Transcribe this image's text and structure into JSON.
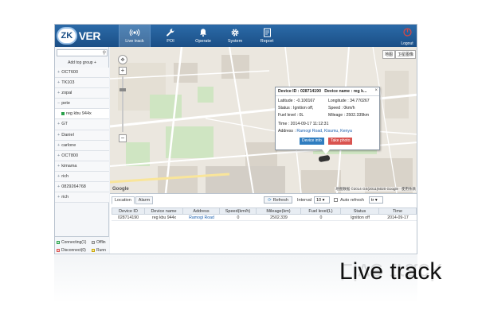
{
  "logo": {
    "mark": "ZK",
    "text": "VER"
  },
  "nav": [
    {
      "label": "Live track",
      "icon": "live-track-icon",
      "active": true
    },
    {
      "label": "POI",
      "icon": "wrench-icon"
    },
    {
      "label": "Operate",
      "icon": "bell-icon"
    },
    {
      "label": "System",
      "icon": "gear-icon"
    },
    {
      "label": "Report",
      "icon": "report-icon"
    }
  ],
  "logout": {
    "label": "Logout",
    "icon": "power-icon"
  },
  "sidebar": {
    "add_group": "Add top group",
    "groups": [
      {
        "label": "OCT600",
        "sign": "+"
      },
      {
        "label": "TK103",
        "sign": "+"
      },
      {
        "label": "zopal",
        "sign": "+"
      },
      {
        "label": "pete",
        "sign": "−"
      },
      {
        "label": "reg kbu 944x",
        "sub": true
      },
      {
        "label": "GT",
        "sign": "+"
      },
      {
        "label": "Daniel",
        "sign": "+"
      },
      {
        "label": "carlone",
        "sign": "+"
      },
      {
        "label": "OCT800",
        "sign": "+"
      },
      {
        "label": "kimama",
        "sign": "+"
      },
      {
        "label": "rich",
        "sign": "+"
      },
      {
        "label": "0829264768",
        "sign": "+"
      },
      {
        "label": "rich",
        "sign": "+"
      }
    ],
    "legend": {
      "connecting": "Connecting(1)",
      "offline": "Offlin",
      "disconnect": "Disconnect(0)",
      "running": "Runn"
    }
  },
  "map": {
    "type_buttons": [
      "地图",
      "卫星图像"
    ],
    "footer": "地图数据 ©2014 GS(2011)6020 Google · 使用条款",
    "google": "Google"
  },
  "popup": {
    "device_id_label": "Device ID :",
    "device_id": "028714190",
    "device_name_label": "Device name :",
    "device_name": "reg k...",
    "latitude_label": "Latitude :",
    "latitude": "-0.100167",
    "longitude_label": "Longitude :",
    "longitude": "34.770267",
    "status_label": "Status :",
    "status": "Ignition off,",
    "speed_label": "Speed :",
    "speed": "0km/h",
    "fuel_label": "Fuel level :",
    "fuel": "0L",
    "mileage_label": "Mileage :",
    "mileage": "2502.339km",
    "time_label": "Time :",
    "time": "2014-09-17 11:12:31",
    "address_label": "Address :",
    "address": "Ramogi Road, Kisumu, Kenya",
    "btn_info": "Device info",
    "btn_photo": "Take photo"
  },
  "bottom": {
    "tabs": [
      "Location",
      "Alarm"
    ],
    "refresh": "Refresh",
    "interval_label": "Interval",
    "interval_value": "10",
    "auto_refresh": "Auto refresh",
    "lang_value": "tr",
    "columns": [
      "Device ID",
      "Device name",
      "Address",
      "Speed(km/h)",
      "Mileage(km)",
      "Fuel level(L)",
      "Status",
      "Time"
    ],
    "rows": [
      [
        "028714190",
        "reg kbu 944x",
        "Ramogi Road",
        "0",
        "2502.339",
        "0",
        "Ignition off",
        "2014-09-17"
      ]
    ]
  },
  "caption": "Live track",
  "colors": {
    "nav_bg": "#1b4f86",
    "accent_blue": "#2f7dc0",
    "photo_red": "#d9534f",
    "online_green": "#2aa14a"
  }
}
